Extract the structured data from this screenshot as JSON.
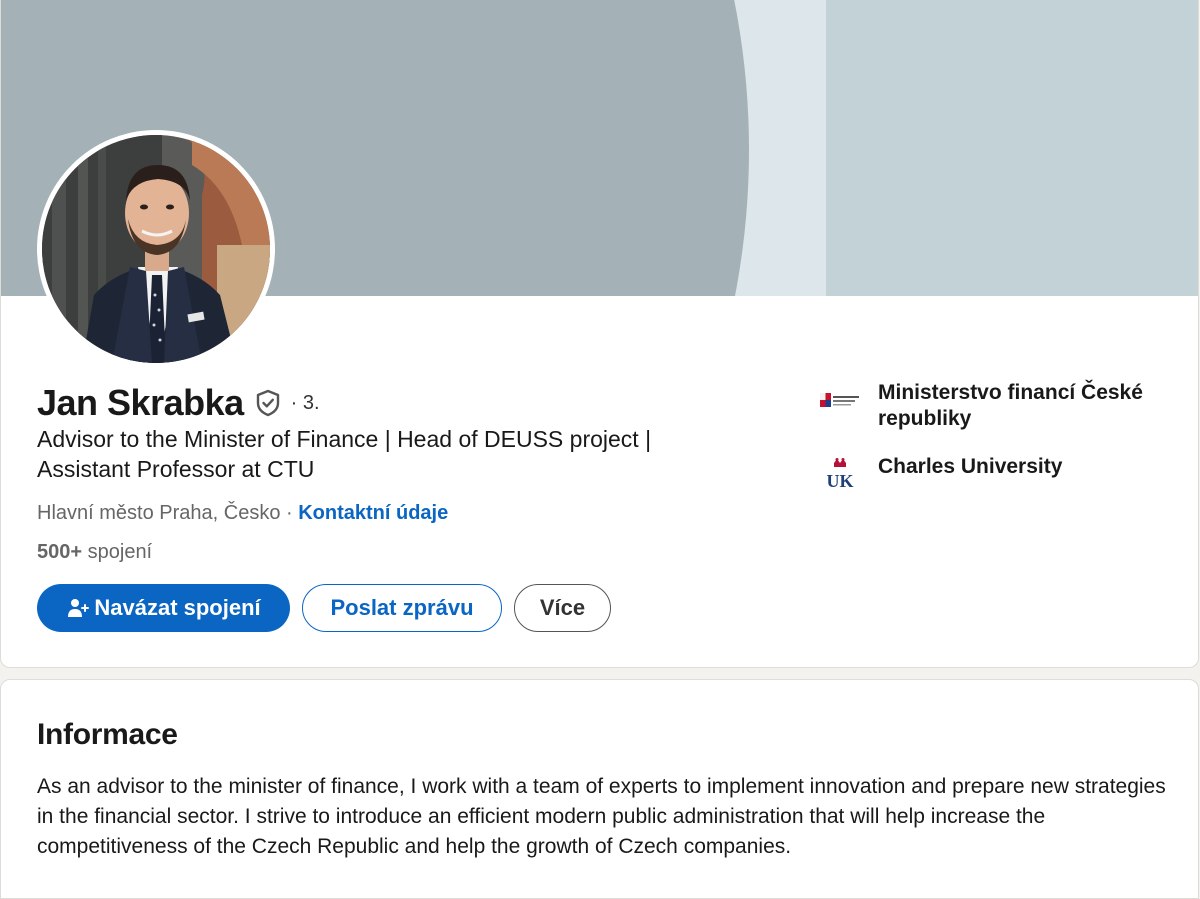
{
  "profile": {
    "name": "Jan Skrabka",
    "degree": "· 3.",
    "headline": "Advisor to the Minister of Finance | Head of DEUSS project | Assistant Professor at CTU",
    "location": "Hlavní město Praha, Česko",
    "location_separator": " · ",
    "contact_link": "Kontaktní údaje",
    "connections_count": "500+",
    "connections_label": "spojení",
    "icons": {
      "verified": "verified-shield-icon",
      "connect": "add-person-icon"
    }
  },
  "actions": {
    "connect_label": "Navázat spojení",
    "message_label": "Poslat zprávu",
    "more_label": "Více"
  },
  "organizations": [
    {
      "name": "Ministerstvo financí České republiky",
      "logo": "ministry-of-finance-logo",
      "logo_text": "Ministerstvo financí České republiky"
    },
    {
      "name": "Charles University",
      "logo": "charles-university-logo",
      "logo_text": "UK"
    }
  ],
  "about": {
    "title": "Informace",
    "text": "As an advisor to the minister of finance, I work with a team of experts to implement innovation and prepare new strategies in the financial sector. I strive to introduce an efficient modern public administration that will help increase the competitiveness of the Czech Republic and help the growth of Czech companies."
  },
  "colors": {
    "accent": "#0a66c2",
    "banner_dark": "#a4b2b7",
    "banner_light": "#dde6ea",
    "banner_right": "#c2d2d7",
    "page_bg": "#f4f2ee"
  }
}
